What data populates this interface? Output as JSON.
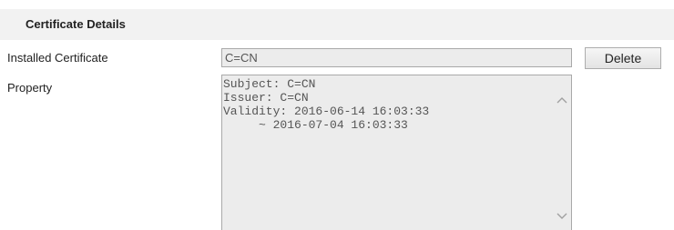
{
  "section": {
    "title": "Certificate Details"
  },
  "installed_certificate": {
    "label": "Installed Certificate",
    "value": "C=CN",
    "delete_label": "Delete"
  },
  "property": {
    "label": "Property",
    "text": "Subject: C=CN\nIssuer: C=CN\nValidity: 2016-06-14 16:03:33\n     ~ 2016-07-04 16:03:33"
  },
  "icons": {
    "scroll_up": "chevron-up-icon",
    "scroll_down": "chevron-down-icon"
  },
  "colors": {
    "header_bg": "#f2f2f2",
    "field_bg": "#ececec",
    "field_border": "#a9a9a9",
    "text": "#222222",
    "field_text": "#555555"
  }
}
